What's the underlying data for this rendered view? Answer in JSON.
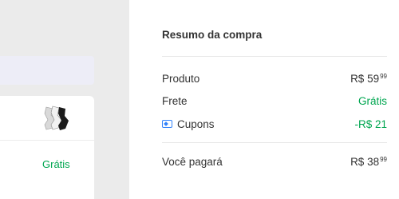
{
  "left": {
    "free_shipping": "Grátis"
  },
  "summary": {
    "title": "Resumo da compra",
    "rows": [
      {
        "label": "Produto",
        "value_main": "R$ 59",
        "value_cents": "99"
      },
      {
        "label": "Frete",
        "value_main": "Grátis",
        "value_cents": ""
      },
      {
        "label": "Cupons",
        "value_main": "-R$ 21",
        "value_cents": ""
      }
    ],
    "total": {
      "label": "Você pagará",
      "value_main": "R$ 38",
      "value_cents": "99"
    }
  },
  "icons": {
    "coupon": "coupon-ticket-icon",
    "product": "product-thumbnail"
  },
  "colors": {
    "green": "#00a650",
    "blue": "#3483fa",
    "background": "#ebebeb"
  }
}
